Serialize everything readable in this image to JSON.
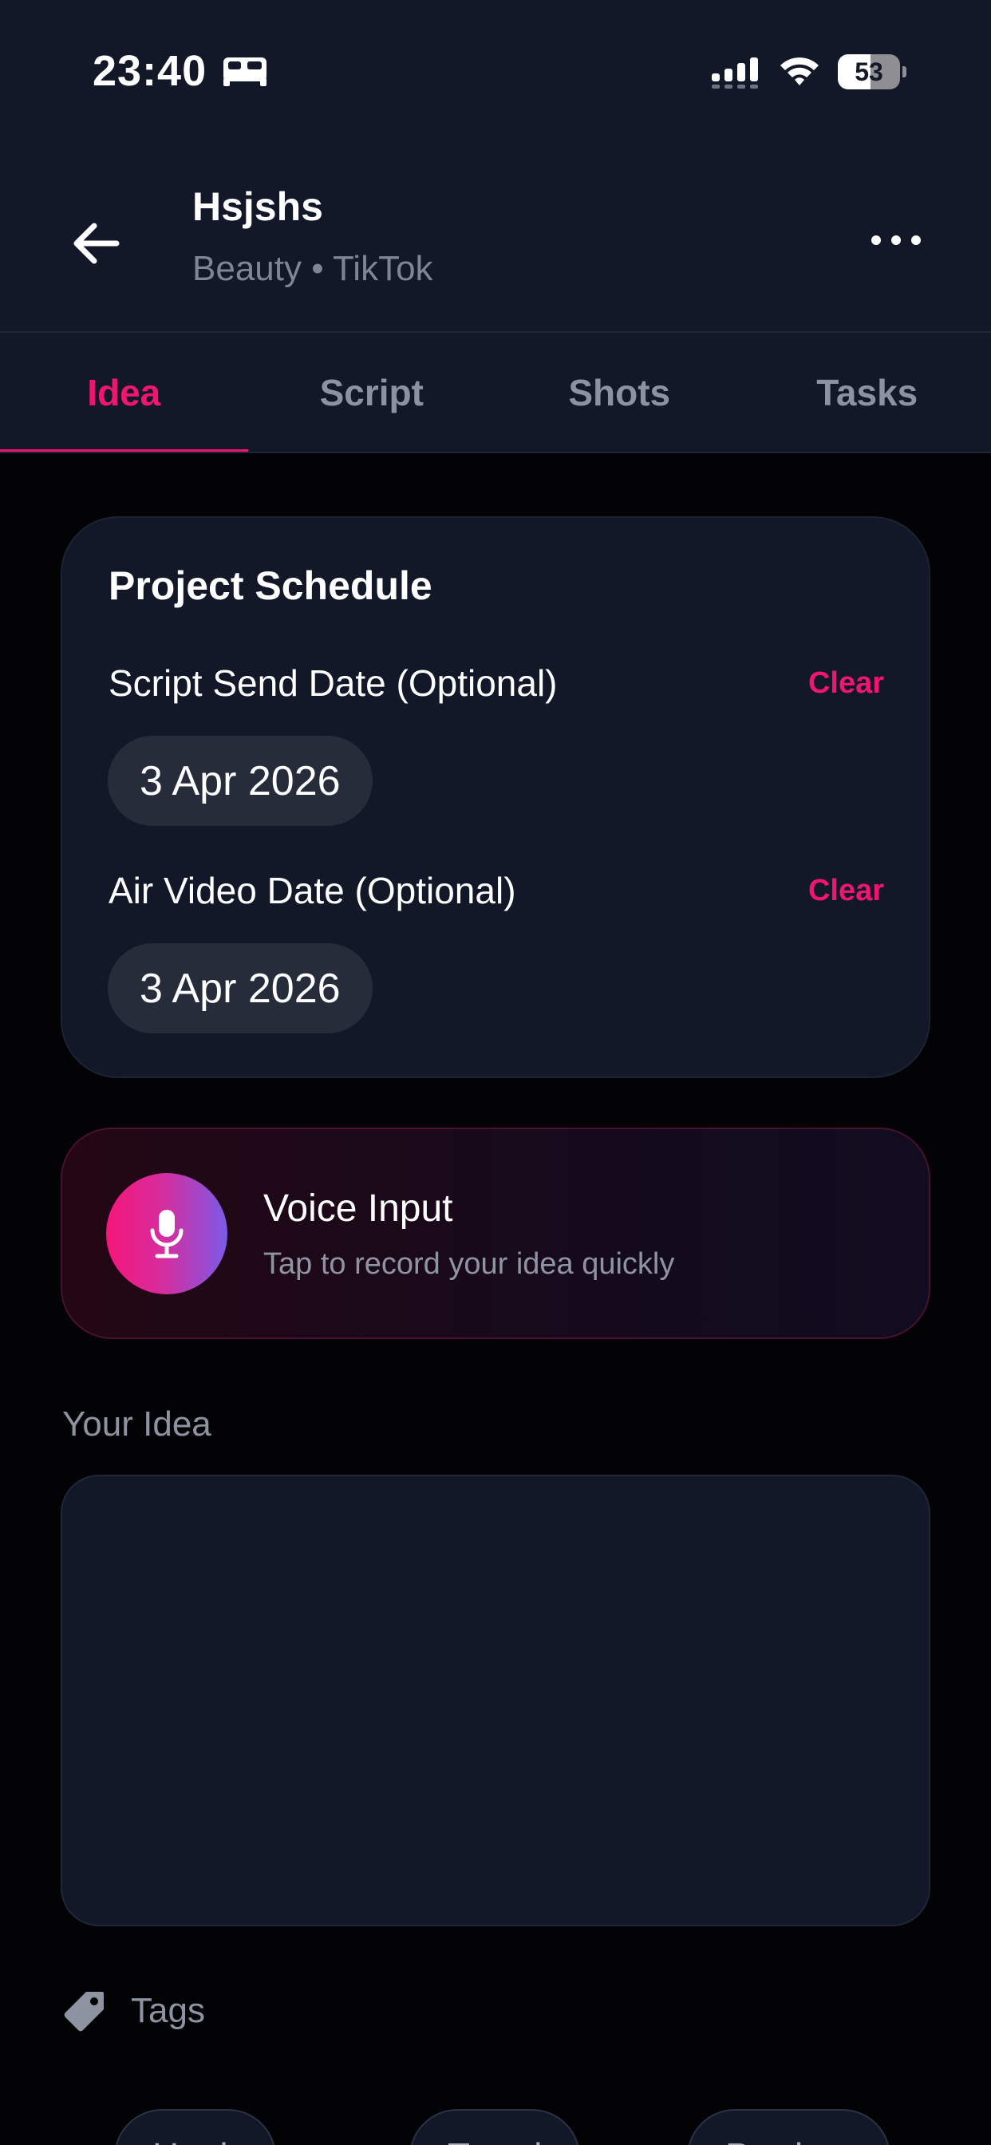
{
  "status_bar": {
    "time": "23:40",
    "battery": "53",
    "battery_level": 0.53
  },
  "header": {
    "title": "Hsjshs",
    "subtitle": "Beauty • TikTok"
  },
  "tabs": [
    {
      "label": "Idea",
      "active": true
    },
    {
      "label": "Script",
      "active": false
    },
    {
      "label": "Shots",
      "active": false
    },
    {
      "label": "Tasks",
      "active": false
    }
  ],
  "schedule": {
    "title": "Project Schedule",
    "fields": [
      {
        "label": "Script Send Date (Optional)",
        "clear_label": "Clear",
        "value": "3 Apr 2026"
      },
      {
        "label": "Air Video Date (Optional)",
        "clear_label": "Clear",
        "value": "3 Apr 2026"
      }
    ]
  },
  "voice_input": {
    "title": "Voice Input",
    "subtitle": "Tap to record your idea quickly"
  },
  "idea": {
    "label": "Your Idea",
    "value": "",
    "placeholder": ""
  },
  "tags": {
    "label": "Tags",
    "chips": [
      "Hook",
      "Trend",
      "Product"
    ]
  },
  "colors": {
    "accent": "#f0166f",
    "header_bg": "#121828",
    "page_bg": "#030305"
  },
  "icons": [
    "bed-icon",
    "signal-icon",
    "wifi-icon",
    "battery-icon",
    "back-arrow-icon",
    "more-icon",
    "microphone-icon",
    "tag-icon"
  ]
}
